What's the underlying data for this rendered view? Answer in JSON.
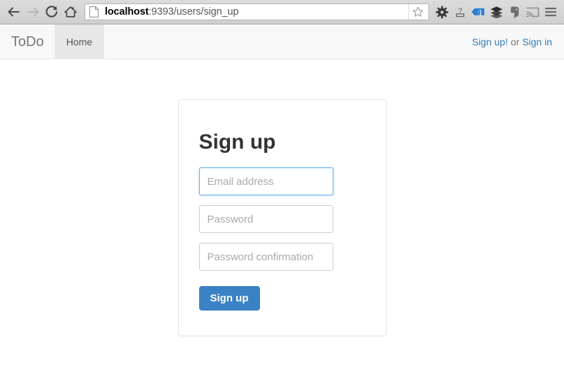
{
  "browser": {
    "back_label": "Back",
    "forward_label": "Forward",
    "reload_label": "Reload",
    "home_label": "Home",
    "url_host": "localhost",
    "url_rest": ":9393/users/sign_up",
    "url_full": "localhost:9393/users/sign_up",
    "page_icon": "page-icon",
    "star_icon": "star-icon",
    "extensions": [
      {
        "name": "gear-icon",
        "title": "Settings"
      },
      {
        "name": "question-mark-icon",
        "title": "Help"
      },
      {
        "name": "blue-tag-icon",
        "title": "Tag"
      },
      {
        "name": "layers-icon",
        "title": "Buffer"
      },
      {
        "name": "elephant-icon",
        "title": "Evernote"
      },
      {
        "name": "cast-icon",
        "title": "Cast"
      },
      {
        "name": "hamburger-menu-icon",
        "title": "Menu"
      }
    ]
  },
  "navbar": {
    "brand": "ToDo",
    "tabs": [
      {
        "label": "Home",
        "active": true
      }
    ],
    "right": {
      "sign_up_label": "Sign up!",
      "separator": "or",
      "sign_in_label": "Sign in"
    }
  },
  "form": {
    "title": "Sign up",
    "email_placeholder": "Email address",
    "email_value": "",
    "password_placeholder": "Password",
    "password_value": "",
    "password_confirmation_placeholder": "Password confirmation",
    "password_confirmation_value": "",
    "submit_label": "Sign up"
  },
  "colors": {
    "link_blue": "#337ab7",
    "button_blue": "#3b82c4",
    "focus_blue": "#66afe9",
    "navbar_bg": "#f8f8f8",
    "tab_active_bg": "#e7e7e7",
    "placeholder_gray": "#a9a9a9"
  }
}
